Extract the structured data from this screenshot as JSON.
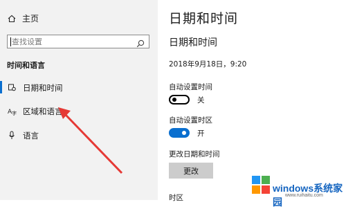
{
  "sidebar": {
    "home_label": "主页",
    "search_placeholder": "查找设置",
    "section_title": "时间和语言",
    "items": [
      {
        "label": "日期和时间",
        "icon": "calendar-clock-icon",
        "active": true
      },
      {
        "label": "区域和语言",
        "icon": "region-language-icon",
        "active": false
      },
      {
        "label": "语言",
        "icon": "microphone-icon",
        "active": false
      }
    ]
  },
  "main": {
    "title": "日期和时间",
    "subtitle": "日期和时间",
    "current_datetime": "2018年9月18日，9:20",
    "auto_time": {
      "label": "自动设置时间",
      "state": "关",
      "on": false
    },
    "auto_timezone": {
      "label": "自动设置时区",
      "state": "开",
      "on": true
    },
    "change_label": "更改日期和时间",
    "change_button": "更改",
    "timezone_label": "时区"
  },
  "watermark": {
    "text": "windows系统家园",
    "url": "www.ruihaitu.com"
  },
  "colors": {
    "sidebar_bg": "#f2f2f2",
    "accent": "#0a6fcf",
    "active_bar": "#0a6fcf",
    "arrow": "#e53935"
  }
}
